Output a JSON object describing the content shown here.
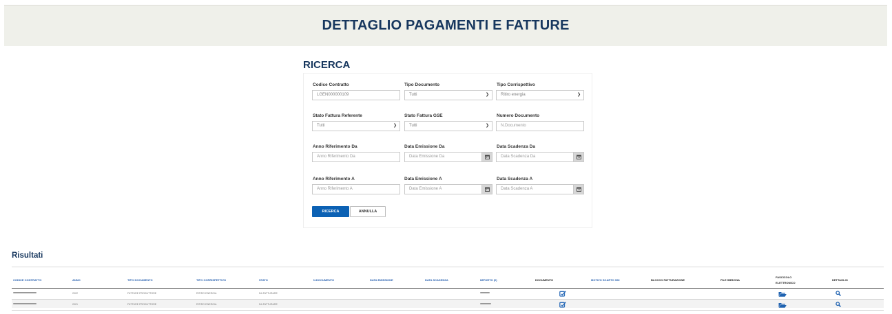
{
  "page": {
    "title": "DETTAGLIO PAGAMENTI E FATTURE"
  },
  "search": {
    "title": "RICERCA",
    "fields": {
      "codice_contratto": {
        "label": "Codice Contratto",
        "value": "LGEN000000109"
      },
      "tipo_documento": {
        "label": "Tipo Documento",
        "value": "Tutti"
      },
      "tipo_corrispettivo": {
        "label": "Tipo Corrispettivo",
        "value": "Ritiro energia"
      },
      "stato_fattura_referente": {
        "label": "Stato Fattura Referente",
        "value": "Tutti"
      },
      "stato_fattura_gse": {
        "label": "Stato Fattura GSE",
        "value": "Tutti"
      },
      "numero_documento": {
        "label": "Numero Documento",
        "placeholder": "N.Documento"
      },
      "anno_riferimento_da": {
        "label": "Anno Riferimento Da",
        "placeholder": "Anno Riferimento Da"
      },
      "data_emissione_da": {
        "label": "Data Emissione Da",
        "placeholder": "Data Emissione Da"
      },
      "data_scadenza_da": {
        "label": "Data Scadenza Da",
        "placeholder": "Data Scadenza Da"
      },
      "anno_riferimento_a": {
        "label": "Anno Riferimento A",
        "placeholder": "Anno Riferimento A"
      },
      "data_emissione_a": {
        "label": "Data Emissione A",
        "placeholder": "Data Emissione A"
      },
      "data_scadenza_a": {
        "label": "Data Scadenza A",
        "placeholder": "Data Scadenza A"
      }
    },
    "buttons": {
      "search": "RICERCA",
      "cancel": "ANNULLA"
    }
  },
  "results": {
    "title": "Risultati",
    "columns": {
      "codice_contratto": "CODICE CONTRATTO",
      "anno": "ANNO",
      "tipo_documento": "TIPO DOCUMENTO",
      "tipo_corrispettivo": "TIPO CORRISPETTIVO",
      "stato": "STATO",
      "n_documento": "N.DOCUMENTO",
      "data_emissione": "DATA EMISSIONE",
      "data_scadenza": "DATA SCADENZA",
      "importo": "IMPORTO (€)",
      "documento": "DOCUMENTO",
      "motivo_scarto_sdi": "MOTIVO SCARTO SDI",
      "blocco_fatturazione": "BLOCCO FATTURAZIONE",
      "file_sbr_cna": "FILE SBR/CNA",
      "fascicolo_line1": "FASCICOLO",
      "fascicolo_line2": "ELETTRONICO",
      "dettaglio": "DETTAGLIO"
    },
    "rows": [
      {
        "anno": "2022",
        "tipo_documento": "FATTURE PRODUTTORE",
        "tipo_corrispettivo": "RITIRO ENERGIA",
        "stato": "DA FATTURARE"
      },
      {
        "anno": "2021",
        "tipo_documento": "FATTURE PRODUTTORE",
        "tipo_corrispettivo": "RITIRO ENERGIA",
        "stato": "DA FATTURARE"
      }
    ]
  },
  "icons": {
    "select_caret": "chevron-down-icon",
    "date_picker": "calendar-icon",
    "documento": "edit-document-icon",
    "fascicolo": "folder-open-icon",
    "dettaglio": "search-icon"
  },
  "colors": {
    "accent": "#0b61b4",
    "title": "#17375e",
    "link": "#2a62b0",
    "header_band": "#eff0ea"
  }
}
